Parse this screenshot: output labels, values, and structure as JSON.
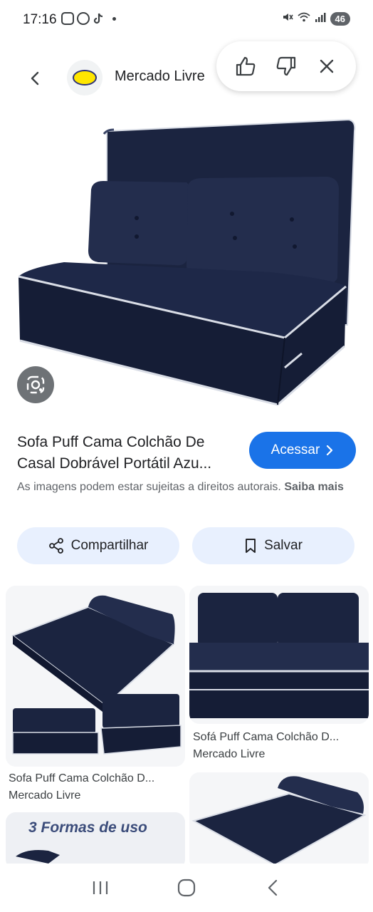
{
  "status": {
    "time": "17:16",
    "battery": "46"
  },
  "header": {
    "site_name": "Mercado Livre",
    "back_icon": "chevron-left-icon",
    "like_icon": "thumb-up-icon",
    "dislike_icon": "thumb-down-icon",
    "close_icon": "close-icon"
  },
  "result": {
    "title": "Sofa Puff Cama Colchão De Casal Dobrável Portátil Azu...",
    "access_label": "Acessar",
    "rights_text": "As imagens podem estar sujeitas a direitos autorais.",
    "rights_link": "Saiba mais",
    "share_label": "Compartilhar",
    "save_label": "Salvar"
  },
  "related": [
    {
      "caption": "Sofa Puff Cama Colchão D...",
      "source": "Mercado Livre"
    },
    {
      "caption": "Sofá Puff Cama Colchão D...",
      "source": "Mercado Livre"
    },
    {
      "caption": "3 Formas de uso",
      "source": ""
    }
  ],
  "colors": {
    "accent": "#1a73e8",
    "tonal": "#e8f0fe",
    "sofa": "#1b2440",
    "piping": "#d9dde6"
  }
}
